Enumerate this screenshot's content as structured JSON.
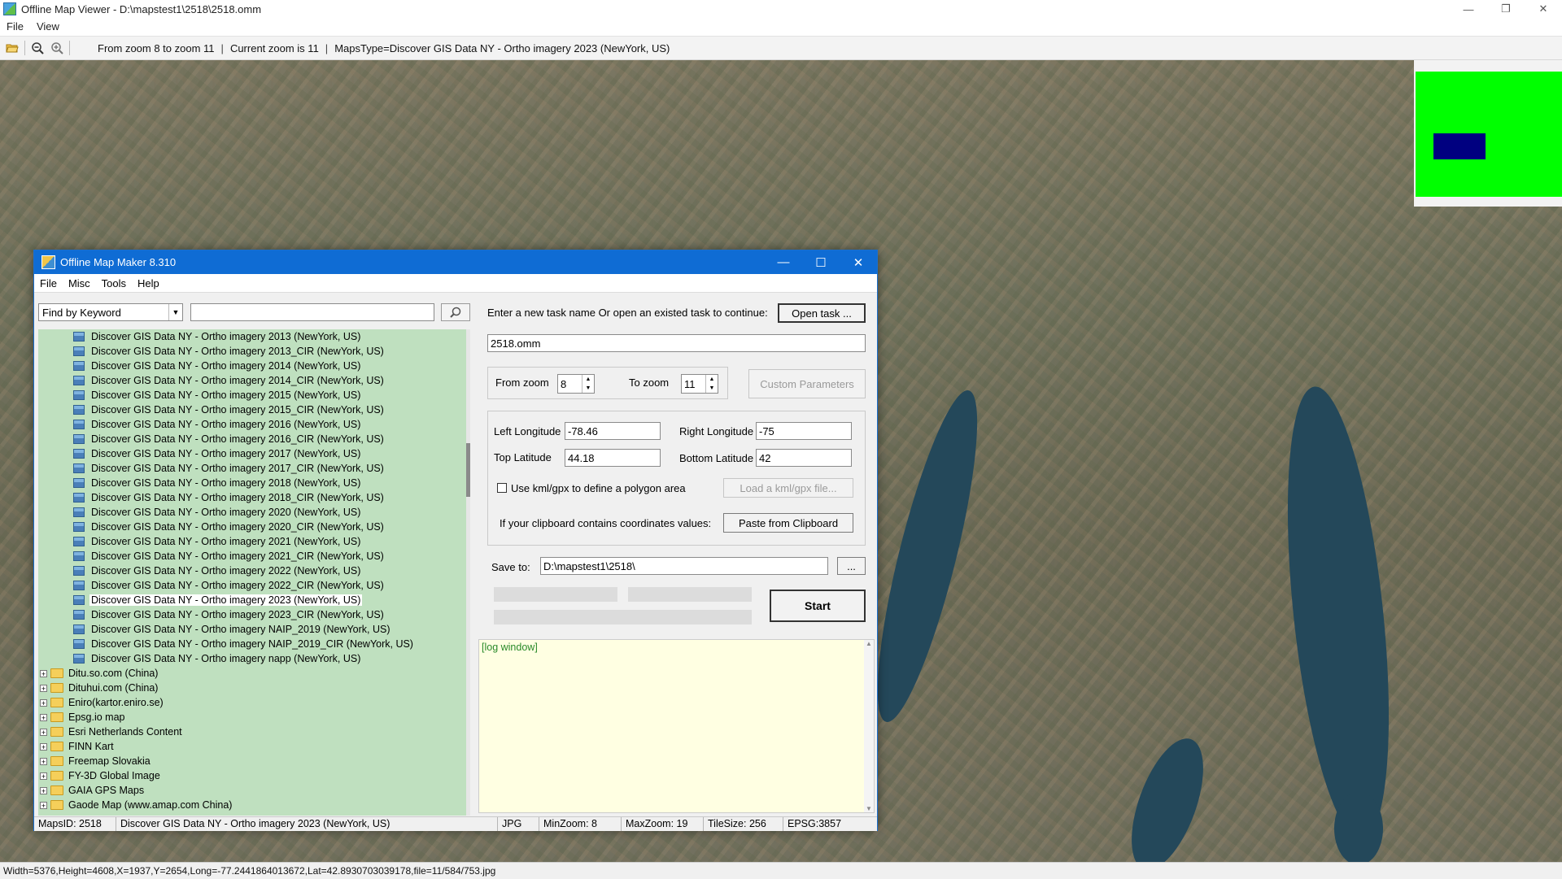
{
  "viewer": {
    "title": "Offline Map Viewer - D:\\mapstest1\\2518\\2518.omm",
    "menu": [
      "File",
      "View"
    ],
    "toolbar": {
      "zoom_range": "From zoom 8 to zoom 11",
      "current_zoom": "Current zoom is 11",
      "maps_type": "MapsType=Discover GIS Data NY - Ortho imagery 2023 (NewYork, US)"
    },
    "status": "Width=5376,Height=4608,X=1937,Y=2654,Long=-77.2441864013672,Lat=42.8930703039178,file=11/584/753.jpg",
    "window_controls": {
      "minimize": "—",
      "maximize": "❐",
      "close": "✕"
    }
  },
  "dialog": {
    "title": "Offline Map Maker 8.310",
    "window_controls": {
      "minimize": "—",
      "maximize": "☐",
      "close": "✕"
    },
    "menu": [
      "File",
      "Misc",
      "Tools",
      "Help"
    ],
    "search": {
      "mode": "Find by Keyword",
      "value": ""
    },
    "tree": {
      "children": [
        "Discover GIS Data NY - Ortho imagery 2013 (NewYork, US)",
        "Discover GIS Data NY - Ortho imagery 2013_CIR (NewYork, US)",
        "Discover GIS Data NY - Ortho imagery 2014 (NewYork, US)",
        "Discover GIS Data NY - Ortho imagery 2014_CIR (NewYork, US)",
        "Discover GIS Data NY - Ortho imagery 2015 (NewYork, US)",
        "Discover GIS Data NY - Ortho imagery 2015_CIR (NewYork, US)",
        "Discover GIS Data NY - Ortho imagery 2016 (NewYork, US)",
        "Discover GIS Data NY - Ortho imagery 2016_CIR (NewYork, US)",
        "Discover GIS Data NY - Ortho imagery 2017 (NewYork, US)",
        "Discover GIS Data NY - Ortho imagery 2017_CIR (NewYork, US)",
        "Discover GIS Data NY - Ortho imagery 2018 (NewYork, US)",
        "Discover GIS Data NY - Ortho imagery 2018_CIR (NewYork, US)",
        "Discover GIS Data NY - Ortho imagery 2020 (NewYork, US)",
        "Discover GIS Data NY - Ortho imagery 2020_CIR (NewYork, US)",
        "Discover GIS Data NY - Ortho imagery 2021 (NewYork, US)",
        "Discover GIS Data NY - Ortho imagery 2021_CIR (NewYork, US)",
        "Discover GIS Data NY - Ortho imagery 2022 (NewYork, US)",
        "Discover GIS Data NY - Ortho imagery 2022_CIR (NewYork, US)",
        "Discover GIS Data NY - Ortho imagery 2023 (NewYork, US)",
        "Discover GIS Data NY - Ortho imagery 2023_CIR (NewYork, US)",
        "Discover GIS Data NY - Ortho imagery NAIP_2019 (NewYork, US)",
        "Discover GIS Data NY - Ortho imagery NAIP_2019_CIR (NewYork, US)",
        "Discover GIS Data NY - Ortho imagery napp (NewYork, US)"
      ],
      "selected": "Discover GIS Data NY - Ortho imagery 2023 (NewYork, US)",
      "folders": [
        "Ditu.so.com (China)",
        "Dituhui.com (China)",
        "Eniro(kartor.eniro.se)",
        "Epsg.io map",
        "Esri Netherlands Content",
        "FINN Kart",
        "Freemap Slovakia",
        "FY-3D Global Image",
        "GAIA GPS Maps",
        "Gaode Map (www.amap.com China)"
      ]
    },
    "task": {
      "prompt": "Enter a new task name Or open an existed task to continue:",
      "open_button": "Open task ...",
      "name": "2518.omm"
    },
    "zoom": {
      "from_label": "From zoom",
      "from_value": "8",
      "to_label": "To zoom",
      "to_value": "11",
      "custom_button": "Custom Parameters"
    },
    "coords": {
      "left_lon_label": "Left Longitude",
      "left_lon": "-78.46",
      "right_lon_label": "Right Longitude",
      "right_lon": "-75",
      "top_lat_label": "Top Latitude",
      "top_lat": "44.18",
      "bottom_lat_label": "Bottom Latitude",
      "bottom_lat": "42",
      "kml_label": "Use kml/gpx to define a polygon area",
      "kml_checked": false,
      "load_kml_button": "Load a kml/gpx file...",
      "clipboard_label": "If your clipboard contains coordinates values:",
      "paste_button": "Paste from Clipboard"
    },
    "save": {
      "label": "Save to:",
      "path": "D:\\mapstest1\\2518\\",
      "browse_button": "..."
    },
    "start_button": "Start",
    "log": "[log window]",
    "status": {
      "maps_id": "MapsID: 2518",
      "name": "Discover GIS Data NY - Ortho imagery 2023 (NewYork, US)",
      "format": "JPG",
      "min_zoom": "MinZoom: 8",
      "max_zoom": "MaxZoom: 19",
      "tile_size": "TileSize: 256",
      "epsg": "EPSG:3857"
    }
  }
}
